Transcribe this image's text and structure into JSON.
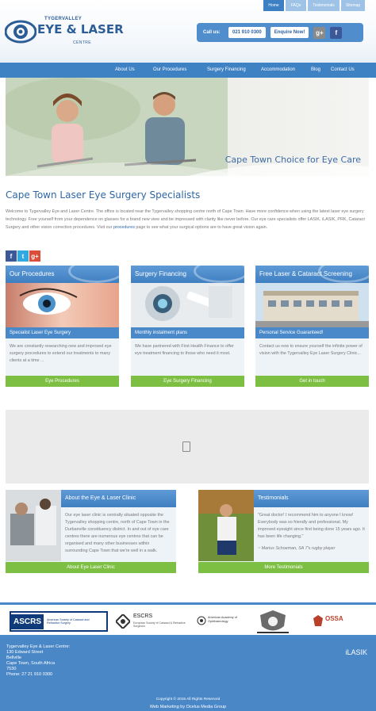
{
  "top_nav": [
    "Home",
    "FAQs",
    "Testimonials",
    "Sitemap"
  ],
  "logo": {
    "line1": "TYGERVALLEY",
    "line2": "EYE & LASER",
    "line3": "CENTRE"
  },
  "contact": {
    "call_label": "Call us:",
    "phone": "021 910 0300",
    "enquire": "Enquire Now!",
    "google": "g+",
    "facebook": "f"
  },
  "main_nav": [
    "About Us",
    "Our Procedures",
    "Surgery Financing",
    "Accommodation",
    "Blog",
    "Contact Us"
  ],
  "hero": {
    "caption": "Cape Town Choice for Eye Care"
  },
  "page_title": "Cape Town Laser Eye Surgery Specialists",
  "intro": {
    "text1": "Welcome to Tygervalley Eye and Laser Centre. The office is located near the Tygervalley shopping centre north of Cape Town. Have more confidence when using the latest laser eye surgery technology. Free yourself from your dependence on glasses for a brand new view and be impressed with clarity like never before. Our eye care specialists offer LASIK, iLASIK, PRK, Cataract Surgery and other vision correction procedures. Visit our ",
    "link": "procedures",
    "text2": " page to see what your surgical options are to have great vision again."
  },
  "social": [
    "f",
    "t",
    "g+"
  ],
  "cards": [
    {
      "title": "Our Procedures",
      "subtitle": "Specialist Laser Eye Surgery",
      "text": "We are constantly researching new and improved eye surgery procedures to extend our treatments to many clients at a time ...",
      "button": "Eye Procedures"
    },
    {
      "title": "Surgery Financing",
      "subtitle": "Monthly instalment plans",
      "text": "We have partnered with First Health Finance to offer eye treatment financing to those who need it most.",
      "button": "Eye Surgery Financing"
    },
    {
      "title": "Free Laser & Cataract Screening",
      "subtitle": "Personal Service Guaranteed!",
      "text": "Contact us now to ensure yourself the infinite power of vision with the Tygervalley Eye Laser Surgery Clinic...",
      "button": "Get in touch"
    }
  ],
  "about": {
    "title": "About the Eye & Laser Clinic",
    "text": "Our eye laser clinic is centrally situated opposite the Tygervalley shopping centre, north of Cape Town in the Durbanville constituency district. In and out of eye care centres there are numerous eye centres that can be organised and many other businesses within surrounding Cape Town that we're well in a walk.",
    "button": "About Eye Laser Clinic"
  },
  "testimonials": {
    "title": "Testimonials",
    "text": "\"Great doctor! I recommend him to anyone I know! Everybody was so friendly and professional. My improved eyesight since first being done 15 years ago. It has been life changing.\"",
    "author": "~ Marius Schoeman, SA 7's rugby player",
    "button": "More Testimonials"
  },
  "logos": [
    "ASCRS",
    "American Society of Cataract and Refractive Surgery",
    "ESCRS",
    "European Society of Cataract & Refractive Surgeons",
    "American Academy of Ophthalmology",
    "OSSA"
  ],
  "footer": {
    "address": [
      "Tygervalley Eye & Laser Centre:",
      "130 Edward Street",
      "Bellville",
      "Cape Town, South Africa",
      "7530",
      "Phone: 27 21 910 0300"
    ],
    "ilasik": "iLASIK",
    "copyright": "Copyright © 2015 All Rights Reserved",
    "web_marketing": "Web Marketing by Ocelus Media Group"
  },
  "colors": {
    "brand_blue": "#3f82c4",
    "button_green": "#7dbf43",
    "footer_blue": "#4a87c7"
  }
}
